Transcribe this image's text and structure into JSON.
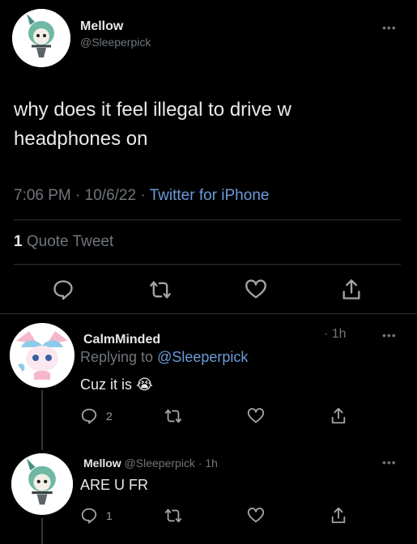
{
  "main_tweet": {
    "display_name": "Mellow",
    "handle": "@Sleeperpick",
    "text": "why does it feel illegal to drive w headphones on",
    "time": "7:06 PM",
    "date": "10/6/22",
    "source": "Twitter for iPhone",
    "quote_count": "1",
    "quote_label": "Quote Tweet"
  },
  "reply1": {
    "display_name": "CalmMinded",
    "time_ago": "1h",
    "replying_to_label": "Replying to",
    "replying_to_handle": "@Sleeperpick",
    "text": "Cuz it is 😭",
    "reply_count": "2"
  },
  "reply2": {
    "display_name": "Mellow",
    "handle": "@Sleeperpick",
    "time_ago": "1h",
    "text": "ARE U FR",
    "reply_count": "1"
  },
  "colors": {
    "link": "#6a9bd8",
    "muted": "#71767b",
    "background": "#000000"
  },
  "icons": [
    "reply-icon",
    "retweet-icon",
    "like-icon",
    "share-icon",
    "more-icon"
  ]
}
